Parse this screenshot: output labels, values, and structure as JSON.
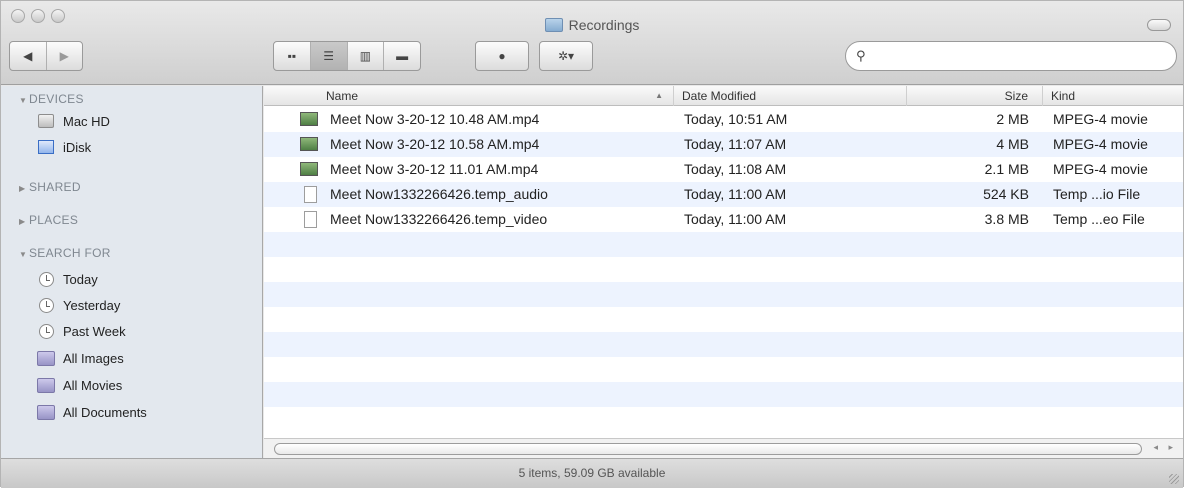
{
  "window": {
    "title": "Recordings",
    "status": "5 items, 59.09 GB available"
  },
  "toolbar": {
    "back_glyph": "◀",
    "forward_glyph": "▶",
    "view_icons": [
      "icon-view-icon",
      "list-view-icon",
      "column-view-icon",
      "coverflow-view-icon"
    ],
    "view_glyphs": [
      "▪▪",
      "☰",
      "▥",
      "▬"
    ],
    "active_view": "list",
    "quicklook_glyph": "●",
    "action_glyph": "✲▾",
    "search": {
      "value": "",
      "placeholder": "",
      "glyph": "⚲"
    }
  },
  "sidebar": {
    "sections": [
      {
        "label": "DEVICES",
        "expanded": true,
        "tri": "▼"
      },
      {
        "label": "SHARED",
        "expanded": false,
        "tri": "▶"
      },
      {
        "label": "PLACES",
        "expanded": false,
        "tri": "▶"
      },
      {
        "label": "SEARCH FOR",
        "expanded": true,
        "tri": "▼"
      }
    ],
    "devices": [
      {
        "label": "Mac HD",
        "icon": "hard-drive-icon"
      },
      {
        "label": "iDisk",
        "icon": "idisk-icon"
      }
    ],
    "search_for": [
      {
        "label": "Today",
        "icon": "clock-icon"
      },
      {
        "label": "Yesterday",
        "icon": "clock-icon"
      },
      {
        "label": "Past Week",
        "icon": "clock-icon"
      },
      {
        "label": "All Images",
        "icon": "smart-folder-icon"
      },
      {
        "label": "All Movies",
        "icon": "smart-folder-icon"
      },
      {
        "label": "All Documents",
        "icon": "smart-folder-icon"
      }
    ]
  },
  "list": {
    "columns": [
      "Name",
      "Date Modified",
      "Size",
      "Kind"
    ],
    "sort_glyph": "▲",
    "rows": [
      {
        "name": "Meet Now 3-20-12 10.48 AM.mp4",
        "date": "Today, 10:51 AM",
        "size": "2 MB",
        "kind": "MPEG-4 movie",
        "icon": "movie-icon"
      },
      {
        "name": "Meet Now 3-20-12 10.58 AM.mp4",
        "date": "Today, 11:07 AM",
        "size": "4 MB",
        "kind": "MPEG-4 movie",
        "icon": "movie-icon"
      },
      {
        "name": "Meet Now 3-20-12 11.01 AM.mp4",
        "date": "Today, 11:08 AM",
        "size": "2.1 MB",
        "kind": "MPEG-4 movie",
        "icon": "movie-icon"
      },
      {
        "name": "Meet Now1332266426.temp_audio",
        "date": "Today, 11:00 AM",
        "size": "524 KB",
        "kind": "Temp ...io File",
        "icon": "document-icon"
      },
      {
        "name": "Meet Now1332266426.temp_video",
        "date": "Today, 11:00 AM",
        "size": "3.8 MB",
        "kind": "Temp ...eo File",
        "icon": "document-icon"
      }
    ]
  },
  "scrollbar": {
    "arrows": "◂ ▸"
  }
}
